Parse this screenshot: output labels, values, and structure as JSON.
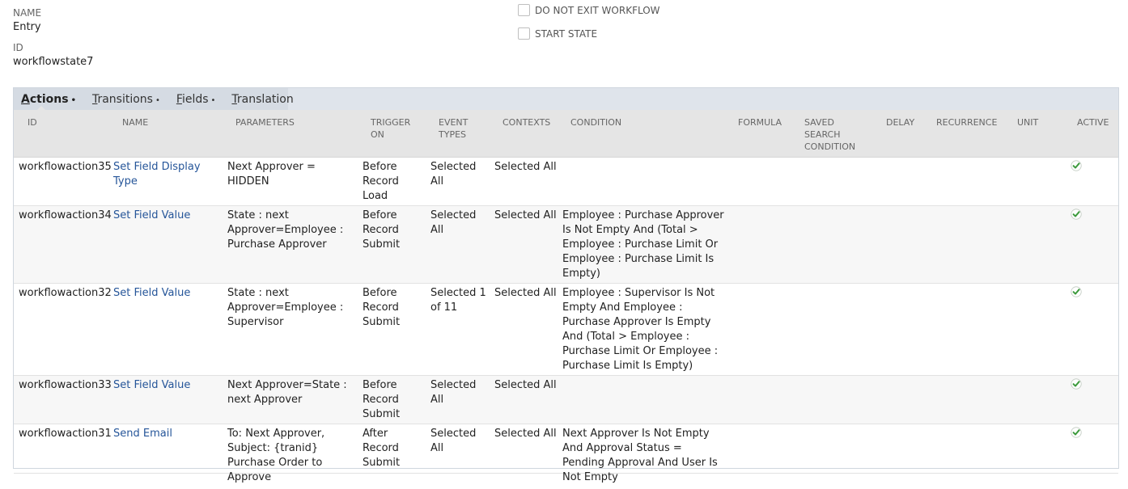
{
  "header": {
    "name_label": "NAME",
    "name_value": "Entry",
    "id_label": "ID",
    "id_value": "workflowstate7",
    "do_not_exit_label": "DO NOT EXIT WORKFLOW",
    "start_state_label": "START STATE"
  },
  "tabs": [
    {
      "first": "A",
      "rest": "ctions",
      "dot": "•"
    },
    {
      "first": "T",
      "rest": "ransitions",
      "dot": "•"
    },
    {
      "first": "F",
      "rest": "ields",
      "dot": "•"
    },
    {
      "first": "T",
      "rest": "ranslation",
      "dot": ""
    }
  ],
  "columns": {
    "id": "ID",
    "name": "NAME",
    "parameters": "PARAMETERS",
    "trigger_on": "TRIGGER ON",
    "event_types": "EVENT TYPES",
    "contexts": "CONTEXTS",
    "condition": "CONDITION",
    "formula": "FORMULA",
    "saved_search_condition": "SAVED SEARCH CONDITION",
    "delay": "DELAY",
    "recurrence": "RECURRENCE",
    "unit": "UNIT",
    "active": "ACTIVE"
  },
  "rows": [
    {
      "id": "workflowaction35",
      "name": "Set Field Display Type",
      "parameters": "Next Approver = HIDDEN",
      "trigger_on": "Before Record Load",
      "event_types": "Selected All",
      "contexts": "Selected All",
      "condition": "",
      "active_icon": "check-icon"
    },
    {
      "id": "workflowaction34",
      "name": "Set Field Value",
      "parameters": "State : next Approver=Employee : Purchase Approver",
      "trigger_on": "Before Record Submit",
      "event_types": "Selected All",
      "contexts": "Selected All",
      "condition": "Employee : Purchase Approver Is Not Empty And (Total > Employee : Purchase Limit Or Employee : Purchase Limit Is Empty)",
      "active_icon": "check-icon"
    },
    {
      "id": "workflowaction32",
      "name": "Set Field Value",
      "parameters": "State : next Approver=Employee : Supervisor",
      "trigger_on": "Before Record Submit",
      "event_types": "Selected 1 of 11",
      "contexts": "Selected All",
      "condition": "Employee : Supervisor Is Not Empty And Employee : Purchase Approver Is Empty And (Total > Employee : Purchase Limit Or Employee : Purchase Limit Is Empty)",
      "active_icon": "check-icon"
    },
    {
      "id": "workflowaction33",
      "name": "Set Field Value",
      "parameters": "Next Approver=State : next Approver",
      "trigger_on": "Before Record Submit",
      "event_types": "Selected All",
      "contexts": "Selected All",
      "condition": "",
      "active_icon": "check-icon"
    },
    {
      "id": "workflowaction31",
      "name": "Send Email",
      "parameters": "To: Next Approver, Subject: {tranid} Purchase Order to Approve",
      "trigger_on": "After Record Submit",
      "event_types": "Selected All",
      "contexts": "Selected All",
      "condition": "Next Approver Is Not Empty And Approval Status = Pending Approval And User Is Not Empty",
      "active_icon": "check-icon"
    }
  ],
  "colors": {
    "link": "#255599",
    "check": "#3c9a3c"
  }
}
